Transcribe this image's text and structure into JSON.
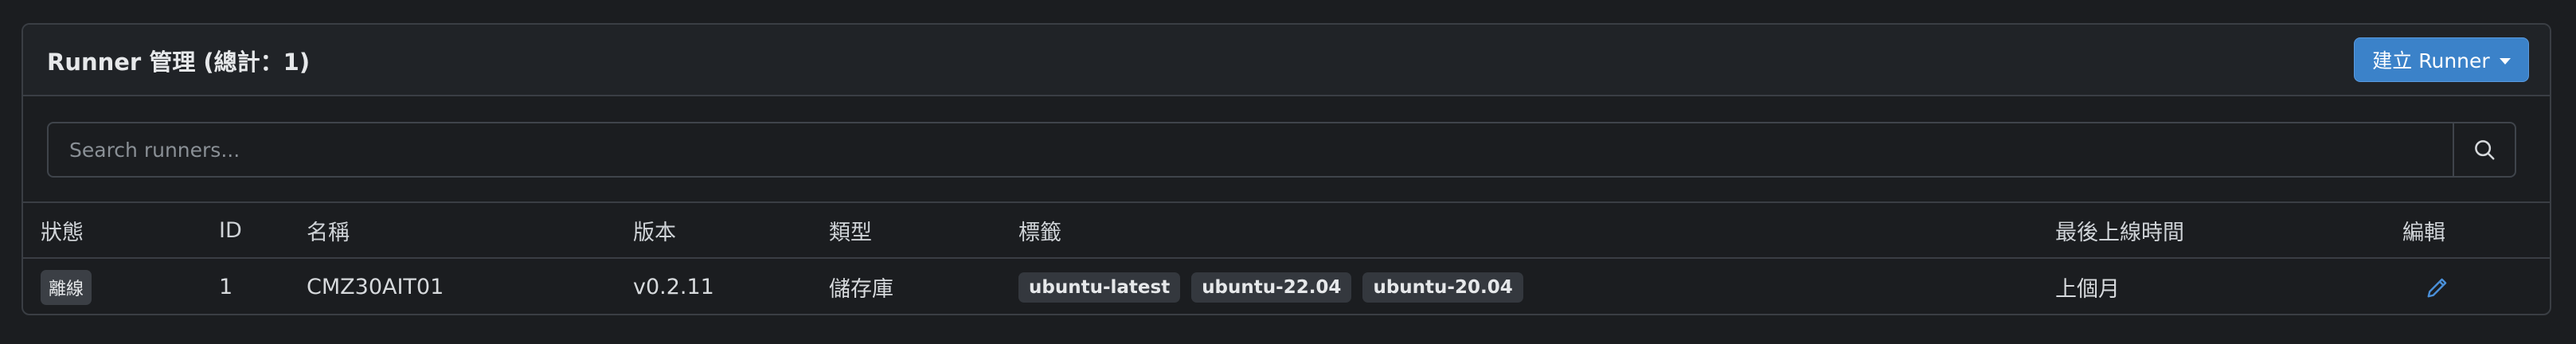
{
  "header": {
    "title": "Runner 管理 (總計：1)",
    "create_button_label": "建立 Runner"
  },
  "search": {
    "placeholder": "Search runners...",
    "value": ""
  },
  "table": {
    "columns": {
      "status": "狀態",
      "id": "ID",
      "name": "名稱",
      "version": "版本",
      "type": "類型",
      "labels": "標籤",
      "last_online": "最後上線時間",
      "edit": "編輯"
    },
    "rows": [
      {
        "status": "離線",
        "id": "1",
        "name": "CMZ30AIT01",
        "version": "v0.2.11",
        "type": "儲存庫",
        "labels": [
          "ubuntu-latest",
          "ubuntu-22.04",
          "ubuntu-20.04"
        ],
        "last_online": "上個月"
      }
    ]
  },
  "icons": {
    "search": "search-icon",
    "dropdown": "caret-down-icon",
    "edit": "pencil-icon"
  },
  "colors": {
    "accent": "#3b82c9",
    "edit_icon": "#4a90d9",
    "background": "#1b1d20",
    "border": "#3a3e44"
  }
}
